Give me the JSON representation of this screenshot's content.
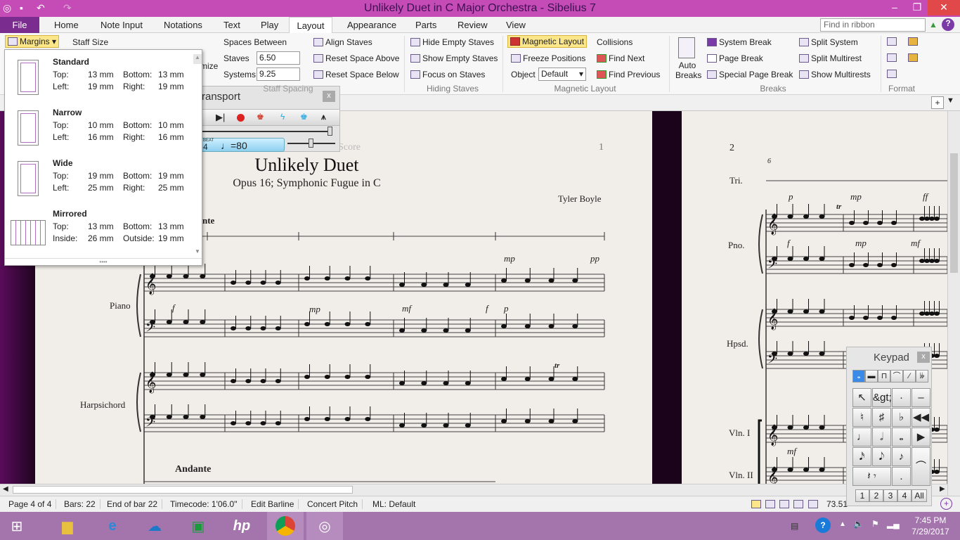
{
  "window": {
    "title": "Unlikely Duet in C Major Orchestra - Sibelius 7",
    "minimize": "‒",
    "restore": "❐",
    "close": "✕"
  },
  "tabs": [
    "File",
    "Home",
    "Note Input",
    "Notations",
    "Text",
    "Play",
    "Layout",
    "Appearance",
    "Parts",
    "Review",
    "View"
  ],
  "active_tab": "Layout",
  "find_placeholder": "Find in ribbon",
  "ribbon": {
    "margins": "Margins",
    "staff_size": "Staff Size",
    "optimize": "mize",
    "spaces_between": "Spaces Between",
    "staves_label": "Staves",
    "staves_value": "6.50",
    "systems_label": "Systems",
    "systems_value": "9.25",
    "align_staves": "Align Staves",
    "reset_above": "Reset Space Above",
    "reset_below": "Reset Space Below",
    "staff_spacing_group": "Staff Spacing",
    "hide_empty": "Hide Empty Staves",
    "show_empty": "Show Empty Staves",
    "focus": "Focus on Staves",
    "hiding_group": "Hiding Staves",
    "magnetic_layout": "Magnetic Layout",
    "freeze": "Freeze Positions",
    "object_label": "Object",
    "object_value": "Default",
    "collisions": "Collisions",
    "find_next": "Find Next",
    "find_previous": "Find Previous",
    "magnetic_group": "Magnetic Layout",
    "auto_breaks": "Auto Breaks",
    "system_break": "System Break",
    "page_break": "Page Break",
    "special_page_break": "Special Page Break",
    "split_system": "Split System",
    "split_multirest": "Split Multirest",
    "show_multirests": "Show Multirests",
    "breaks_group": "Breaks",
    "format_group": "Format"
  },
  "margins_menu": [
    {
      "name": "Standard",
      "top": "13 mm",
      "bottom": "13 mm",
      "left": "19 mm",
      "right": "19 mm",
      "l1": "Top:",
      "l2": "Bottom:",
      "l3": "Left:",
      "l4": "Right:"
    },
    {
      "name": "Narrow",
      "top": "10 mm",
      "bottom": "10 mm",
      "left": "16 mm",
      "right": "16 mm",
      "l1": "Top:",
      "l2": "Bottom:",
      "l3": "Left:",
      "l4": "Right:"
    },
    {
      "name": "Wide",
      "top": "19 mm",
      "bottom": "19 mm",
      "left": "25 mm",
      "right": "25 mm",
      "l1": "Top:",
      "l2": "Bottom:",
      "l3": "Left:",
      "l4": "Right:"
    },
    {
      "name": "Mirrored",
      "top": "13 mm",
      "bottom": "13 mm",
      "left": "26 mm",
      "right": "19 mm",
      "l1": "Top:",
      "l2": "Bottom:",
      "l3": "Inside:",
      "l4": "Outside:"
    }
  ],
  "transport": {
    "title": "ransport",
    "close": "x",
    "beat_label": "BEAT",
    "beat": "4",
    "tempo": "♩=80"
  },
  "keypad": {
    "title": "Keypad",
    "close": "x",
    "tabs": [
      "𝅝",
      "▬",
      "⊓",
      "⌒",
      "⁄",
      "𝄫"
    ],
    "keys": [
      "↖",
      "&gt;",
      "·",
      "–",
      "♮",
      "♯",
      "♭",
      "◀◀",
      "♩",
      "𝅗𝅥",
      "𝅝",
      "▶",
      "𝅘𝅥𝅯",
      "𝅘𝅥𝅮",
      "♪",
      "⌒",
      "𝄽 𝄾",
      "."
    ],
    "layouts": [
      "1",
      "2",
      "3",
      "4",
      "All"
    ]
  },
  "score": {
    "page1": {
      "header": "Full Score",
      "page_number": "1",
      "title": "Unlikely Duet",
      "subtitle": "Opus 16; Symphonic Fugue in C",
      "composer": "Tyler Boyle",
      "tempo_top": "nte",
      "tempo_bottom": "Andante",
      "instruments": [
        "Piano",
        "Harpsichord"
      ],
      "dynamics": [
        "f",
        "mp",
        "mf",
        "f",
        "p",
        "mp",
        "pp",
        "tr"
      ]
    },
    "page2": {
      "page_number": "2",
      "bar_number": "6",
      "instruments": [
        "Tri.",
        "Pno.",
        "Hpsd.",
        "Vln. I",
        "Vln. II"
      ],
      "dynamics": [
        "p",
        "mp",
        "ff",
        "f",
        "mp",
        "mf",
        "mf",
        "tr"
      ]
    }
  },
  "status": [
    "Page 4 of 4",
    "Bars: 22",
    "End of bar 22",
    "Timecode: 1'06.0\"",
    "Edit Barline",
    "Concert Pitch",
    "ML: Default"
  ],
  "zoom_value": "73.51",
  "clock": {
    "time": "7:45 PM",
    "date": "7/29/2017"
  },
  "colors": {
    "titlebar": "#c54bb7",
    "file_tab": "#7b2d8f",
    "taskbar": "#a474ad",
    "highlight": "#fbe68a"
  }
}
